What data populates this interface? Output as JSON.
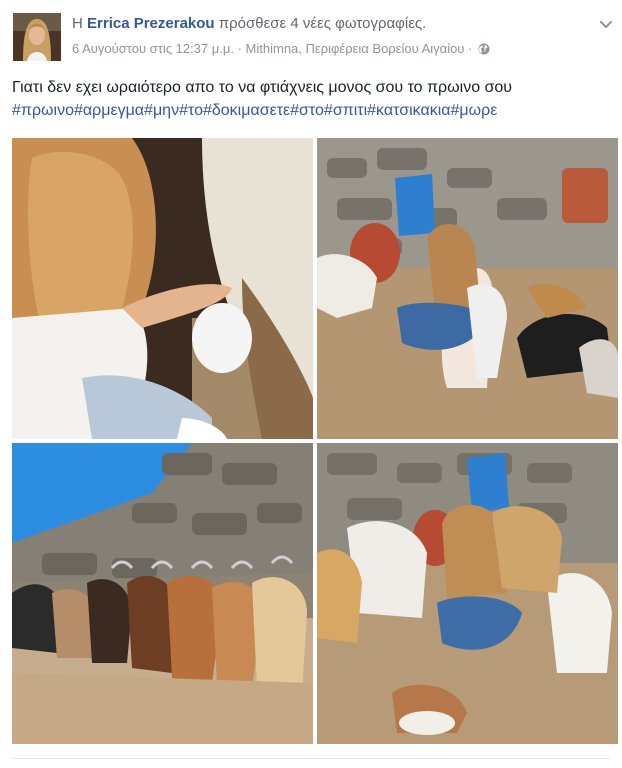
{
  "header": {
    "prefix": "Η",
    "author": "Errica Prezerakou",
    "action": "πρόσθεσε 4 νέες φωτογραφίες.",
    "date": "6 Αυγούστου στις 12:37 μ.μ.",
    "separator": "·",
    "location": "Mithimna, Περιφέρεια Βορείου Αιγαίου",
    "separator2": "·"
  },
  "post": {
    "text": "Γιατι δεν εχει ωραιότερο απο το να φτιάχνεις μονος σου το πρωινο σου",
    "hashtags": "#πρωινο#αρμεγμα#μην#το#δοκιμασετε#στο#σπιτι#κατσικακια#μωρε"
  },
  "icons": {
    "privacy": "globe-icon",
    "menu": "chevron-down-icon"
  },
  "colors": {
    "link": "#365899",
    "meta": "#90949c",
    "text": "#1d2129"
  }
}
